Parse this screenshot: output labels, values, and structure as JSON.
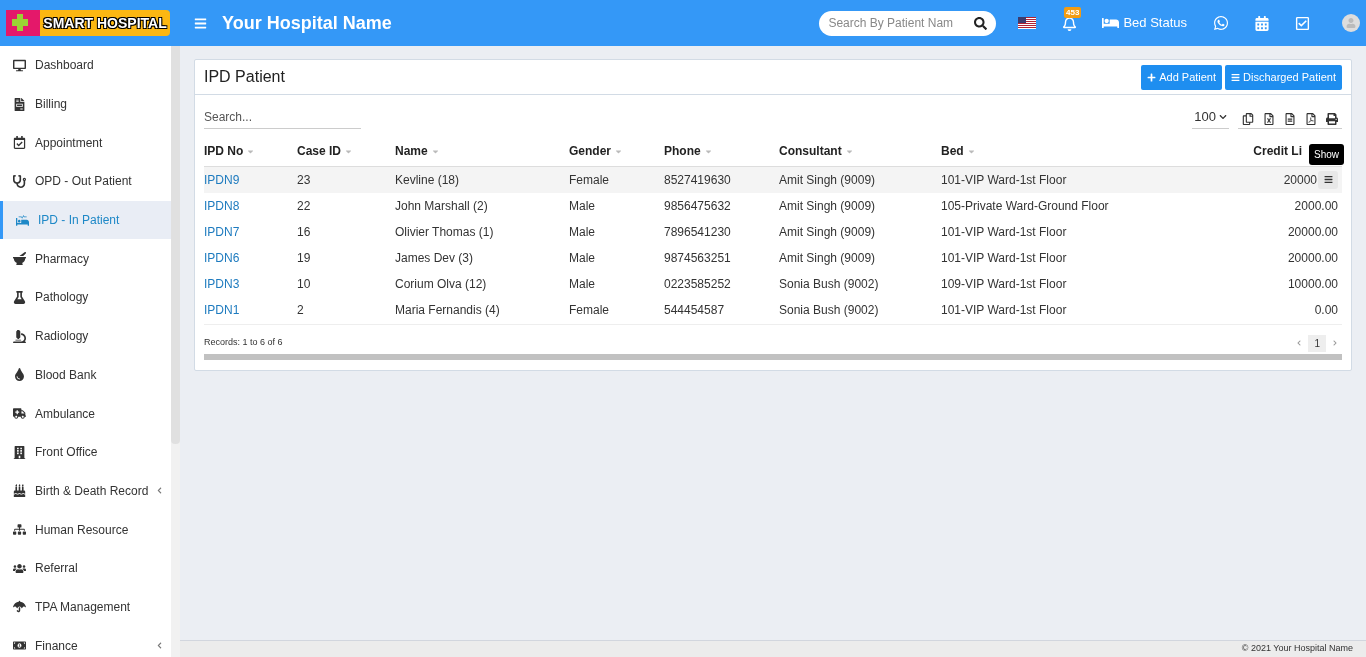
{
  "header": {
    "logo": "SMART HOSPITAL",
    "hospital_name": "Your Hospital Name",
    "search": {
      "placeholder": "Search By Patient Nam"
    },
    "notification_count": "453",
    "bed_status": "Bed Status"
  },
  "sidebar": {
    "items": [
      {
        "label": "Dashboard",
        "selected": false,
        "has_submenu": false
      },
      {
        "label": "Billing",
        "selected": false,
        "has_submenu": false
      },
      {
        "label": "Appointment",
        "selected": false,
        "has_submenu": false
      },
      {
        "label": "OPD - Out Patient",
        "selected": false,
        "has_submenu": false
      },
      {
        "label": "IPD - In Patient",
        "selected": true,
        "has_submenu": false
      },
      {
        "label": "Pharmacy",
        "selected": false,
        "has_submenu": false
      },
      {
        "label": "Pathology",
        "selected": false,
        "has_submenu": false
      },
      {
        "label": "Radiology",
        "selected": false,
        "has_submenu": false
      },
      {
        "label": "Blood Bank",
        "selected": false,
        "has_submenu": false
      },
      {
        "label": "Ambulance",
        "selected": false,
        "has_submenu": false
      },
      {
        "label": "Front Office",
        "selected": false,
        "has_submenu": false
      },
      {
        "label": "Birth & Death Record",
        "selected": false,
        "has_submenu": true
      },
      {
        "label": "Human Resource",
        "selected": false,
        "has_submenu": false
      },
      {
        "label": "Referral",
        "selected": false,
        "has_submenu": false
      },
      {
        "label": "TPA Management",
        "selected": false,
        "has_submenu": false
      },
      {
        "label": "Finance",
        "selected": false,
        "has_submenu": true
      }
    ]
  },
  "panel": {
    "title": "IPD Patient",
    "buttons": [
      {
        "label": "Add Patient",
        "kind": "add"
      },
      {
        "label": "Discharged Patient",
        "kind": "list"
      }
    ],
    "search": {
      "placeholder": "Search..."
    },
    "page_size": "100",
    "table": {
      "columns": [
        "IPD No",
        "Case ID",
        "Name",
        "Gender",
        "Phone",
        "Consultant",
        "Bed",
        "Credit Li"
      ],
      "rows": [
        {
          "cells": [
            "IPDN9",
            "23",
            "Kevline (18)",
            "Female",
            "8527419630",
            "Amit Singh (9009)",
            "101-VIP Ward-1st Floor",
            "20000"
          ],
          "hovered": true
        },
        {
          "cells": [
            "IPDN8",
            "22",
            "John Marshall (2)",
            "Male",
            "9856475632",
            "Amit Singh (9009)",
            "105-Private Ward-Ground Floor",
            "2000.00"
          ],
          "hovered": false
        },
        {
          "cells": [
            "IPDN7",
            "16",
            "Olivier Thomas (1)",
            "Male",
            "7896541230",
            "Amit Singh (9009)",
            "101-VIP Ward-1st Floor",
            "20000.00"
          ],
          "hovered": false
        },
        {
          "cells": [
            "IPDN6",
            "19",
            "James Dev (3)",
            "Male",
            "9874563251",
            "Amit Singh (9009)",
            "101-VIP Ward-1st Floor",
            "20000.00"
          ],
          "hovered": false
        },
        {
          "cells": [
            "IPDN3",
            "10",
            "Corium Olva (12)",
            "Male",
            "0223585252",
            "Sonia Bush (9002)",
            "109-VIP Ward-1st Floor",
            "10000.00"
          ],
          "hovered": false
        },
        {
          "cells": [
            "IPDN1",
            "2",
            "Maria Fernandis (4)",
            "Female",
            "544454587",
            "Sonia Bush (9002)",
            "101-VIP Ward-1st Floor",
            "0.00"
          ],
          "hovered": false
        }
      ]
    },
    "tooltip": "Show",
    "records": "Records: 1 to 6 of 6",
    "current_page": "1"
  },
  "footer": "© 2021 Your Hospital Name"
}
